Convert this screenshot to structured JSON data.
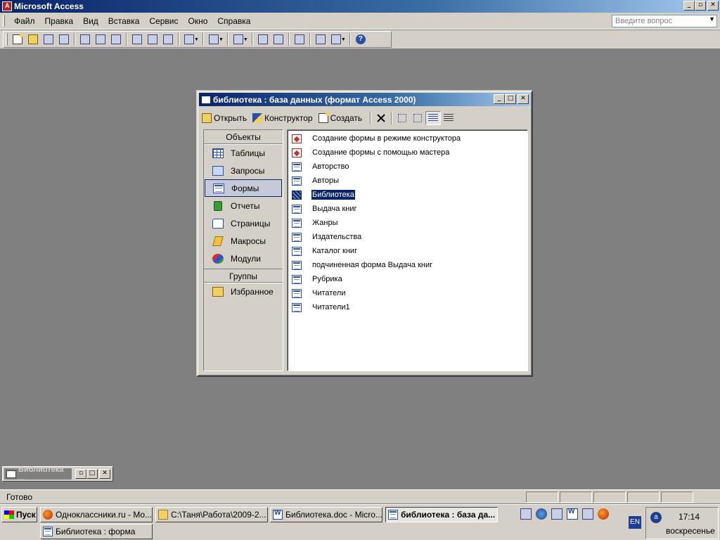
{
  "app": {
    "title": "Microsoft Access",
    "menu": [
      {
        "label": "Файл"
      },
      {
        "label": "Правка"
      },
      {
        "label": "Вид"
      },
      {
        "label": "Вставка"
      },
      {
        "label": "Сервис"
      },
      {
        "label": "Окно"
      },
      {
        "label": "Справка"
      }
    ],
    "ask_placeholder": "Введите вопрос"
  },
  "toolbar_icons": [
    "new-icon",
    "open-icon",
    "save-icon",
    "search-icon",
    "print-icon",
    "print-preview-icon",
    "spelling-icon",
    "cut-icon",
    "copy-icon",
    "paste-icon",
    "undo-icon",
    "analyze-icon",
    "office-links-icon",
    "relationships-icon",
    "code-icon",
    "properties-icon",
    "new-object-icon",
    "help-icon"
  ],
  "db_window": {
    "title": "библиотека : база данных (формат Access 2000)",
    "toolbar": {
      "open_label": "Открыть",
      "design_label": "Конструктор",
      "create_label": "Создать"
    },
    "objects_header": "Объекты",
    "objects": [
      {
        "label": "Таблицы",
        "icon": "table-icon"
      },
      {
        "label": "Запросы",
        "icon": "query-icon"
      },
      {
        "label": "Формы",
        "icon": "form-icon",
        "selected": true
      },
      {
        "label": "Отчеты",
        "icon": "report-icon"
      },
      {
        "label": "Страницы",
        "icon": "page-icon"
      },
      {
        "label": "Макросы",
        "icon": "macro-icon"
      },
      {
        "label": "Модули",
        "icon": "module-icon"
      }
    ],
    "groups_header": "Группы",
    "groups": [
      {
        "label": "Избранное",
        "icon": "favorites-icon"
      }
    ],
    "items": [
      {
        "label": "Создание формы в режиме конструктора",
        "icon": "design-wizard-icon"
      },
      {
        "label": "Создание формы с помощью мастера",
        "icon": "wizard-icon"
      },
      {
        "label": "Авторство",
        "icon": "form-icon"
      },
      {
        "label": "Авторы",
        "icon": "form-icon"
      },
      {
        "label": "Библиотека",
        "icon": "form-icon",
        "selected": true
      },
      {
        "label": "Выдача книг",
        "icon": "form-icon"
      },
      {
        "label": "Жанры",
        "icon": "form-icon"
      },
      {
        "label": "Издательства",
        "icon": "form-icon"
      },
      {
        "label": "Каталог книг",
        "icon": "form-icon"
      },
      {
        "label": "подчиненная форма Выдача книг",
        "icon": "form-icon"
      },
      {
        "label": "Рубрика",
        "icon": "form-icon"
      },
      {
        "label": "Читатели",
        "icon": "form-icon"
      },
      {
        "label": "Читатели1",
        "icon": "form-icon"
      }
    ]
  },
  "minimized_window": {
    "title": "Библиотека ..."
  },
  "status": {
    "text": "Готово"
  },
  "taskbar": {
    "start_label": "Пуск",
    "tasks": [
      {
        "label": "Одноклассники.ru - Mo...",
        "icon": "firefox-icon"
      },
      {
        "label": "C:\\Таня\\Работа\\2009-2...",
        "icon": "folder-icon"
      },
      {
        "label": "Библиотека.doc - Micro...",
        "icon": "word-icon"
      },
      {
        "label": "библиотека : база да...",
        "icon": "access-icon",
        "active": true
      },
      {
        "label": "Библиотека : форма",
        "icon": "form-icon"
      }
    ],
    "lang": "EN",
    "time": "17:14",
    "day": "воскресенье"
  }
}
